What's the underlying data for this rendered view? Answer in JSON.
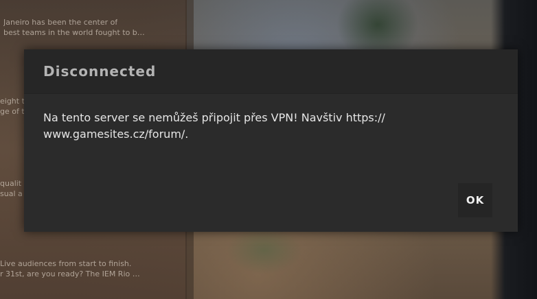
{
  "background": {
    "news_lines": [
      "Janeiro has been the center of",
      "best teams in the world fought to b…",
      "eight t",
      "ge of t",
      "qualit",
      "sual a",
      "Live audiences from start to finish.",
      "r 31st, are you ready? The IEM Rio …"
    ]
  },
  "dialog": {
    "title": "Disconnected",
    "message": "Na tento server se nemůžeš připojit přes VPN! Navštiv https:// www.gamesites.cz/forum/.",
    "ok_label": "OK"
  }
}
